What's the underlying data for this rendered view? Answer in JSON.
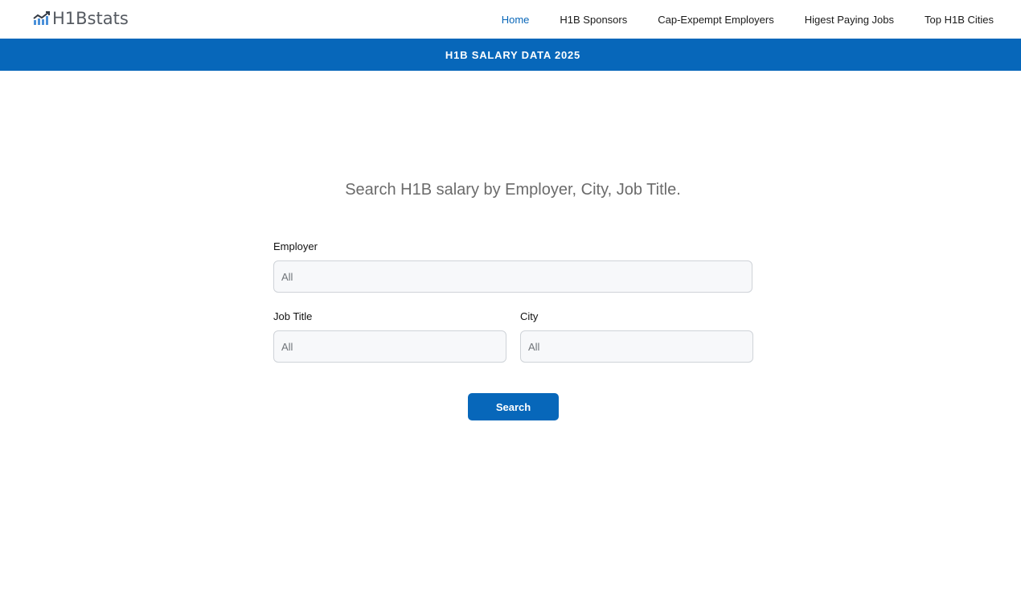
{
  "brand": {
    "logo_text": "H1Bstats",
    "accent_color": "#0767ba"
  },
  "nav": {
    "items": [
      {
        "label": "Home",
        "active": true
      },
      {
        "label": "H1B Sponsors",
        "active": false
      },
      {
        "label": "Cap-Expempt Employers",
        "active": false
      },
      {
        "label": "Higest Paying Jobs",
        "active": false
      },
      {
        "label": "Top H1B Cities",
        "active": false
      }
    ]
  },
  "banner": {
    "title": "H1B SALARY DATA 2025"
  },
  "search": {
    "headline": "Search H1B salary by Employer, City, Job Title.",
    "employer": {
      "label": "Employer",
      "placeholder": "All"
    },
    "job_title": {
      "label": "Job Title",
      "placeholder": "All"
    },
    "city": {
      "label": "City",
      "placeholder": "All"
    },
    "submit_label": "Search"
  }
}
